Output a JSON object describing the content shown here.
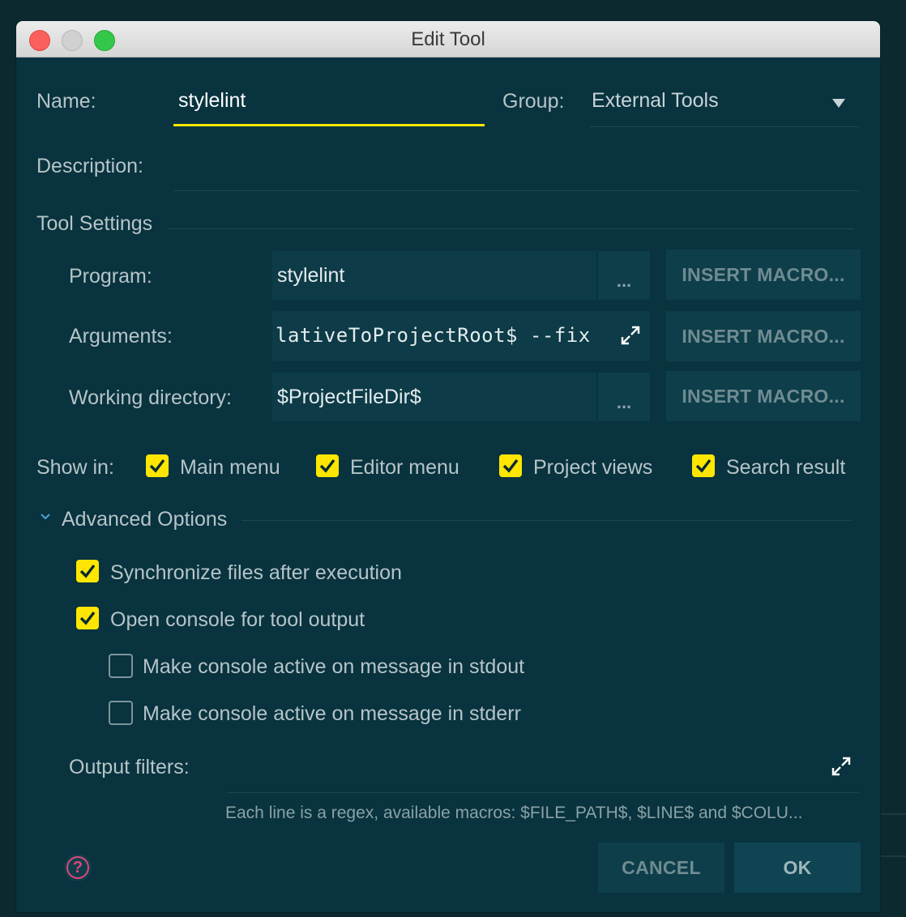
{
  "window": {
    "title": "Edit Tool"
  },
  "name": {
    "label": "Name:",
    "value": "stylelint"
  },
  "group": {
    "label": "Group:",
    "value": "External Tools"
  },
  "description": {
    "label": "Description:",
    "value": ""
  },
  "tool_settings": {
    "heading": "Tool Settings",
    "program": {
      "label": "Program:",
      "value": "stylelint",
      "browse": "...",
      "macro": "INSERT MACRO..."
    },
    "arguments": {
      "label": "Arguments:",
      "value": "lativeToProjectRoot$ --fix",
      "macro": "INSERT MACRO..."
    },
    "working_dir": {
      "label": "Working directory:",
      "value": "$ProjectFileDir$",
      "browse": "...",
      "macro": "INSERT MACRO..."
    }
  },
  "show_in": {
    "label": "Show in:",
    "options": [
      {
        "label": "Main menu",
        "checked": true
      },
      {
        "label": "Editor menu",
        "checked": true
      },
      {
        "label": "Project views",
        "checked": true
      },
      {
        "label": "Search result",
        "checked": true
      }
    ]
  },
  "advanced": {
    "heading": "Advanced Options",
    "sync": {
      "label": "Synchronize files after execution",
      "checked": true
    },
    "console": {
      "label": "Open console for tool output",
      "checked": true
    },
    "stdout": {
      "label": "Make console active on message in stdout",
      "checked": false
    },
    "stderr": {
      "label": "Make console active on message in stderr",
      "checked": false
    },
    "output_filters": {
      "label": "Output filters:",
      "hint": "Each line is a regex, available macros: $FILE_PATH$, $LINE$ and $COLU..."
    }
  },
  "footer": {
    "help": "?",
    "cancel": "CANCEL",
    "ok": "OK"
  },
  "colors": {
    "accent": "#ffe600",
    "background": "#08333f",
    "help": "#e0467c"
  }
}
